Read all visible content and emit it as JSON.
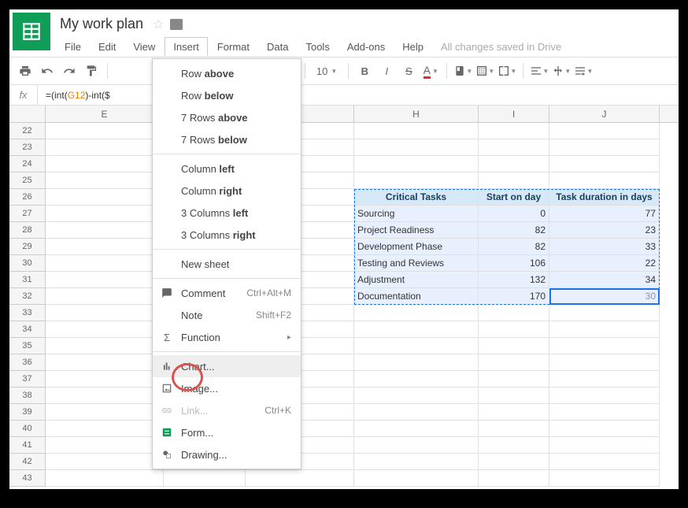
{
  "doc": {
    "title": "My work plan"
  },
  "menu": {
    "file": "File",
    "edit": "Edit",
    "view": "View",
    "insert": "Insert",
    "format": "Format",
    "data": "Data",
    "tools": "Tools",
    "addons": "Add-ons",
    "help": "Help",
    "save_status": "All changes saved in Drive"
  },
  "toolbar": {
    "font_size": "10"
  },
  "formula": {
    "label": "fx",
    "visible": "=(int(G12)-int($"
  },
  "insert_menu": {
    "row_above": "Row above",
    "row_below": "Row below",
    "rows_above": "7 Rows above",
    "rows_below": "7 Rows below",
    "col_left": "Column left",
    "col_right": "Column right",
    "cols_left": "3 Columns left",
    "cols_right": "3 Columns right",
    "new_sheet": "New sheet",
    "comment": "Comment",
    "comment_sc": "Ctrl+Alt+M",
    "note": "Note",
    "note_sc": "Shift+F2",
    "function": "Function",
    "chart": "Chart...",
    "image": "Image...",
    "link": "Link...",
    "link_sc": "Ctrl+K",
    "form": "Form...",
    "drawing": "Drawing..."
  },
  "columns": {
    "E": "E",
    "H": "H",
    "I": "I",
    "J": "J"
  },
  "row_numbers": [
    "22",
    "23",
    "24",
    "25",
    "26",
    "27",
    "28",
    "29",
    "30",
    "31",
    "32",
    "33",
    "34",
    "35",
    "36",
    "37",
    "38",
    "39",
    "40",
    "41",
    "42",
    "43"
  ],
  "table": {
    "header": {
      "h": "Critical Tasks",
      "i": "Start on day",
      "j": "Task duration in days"
    },
    "rows": [
      {
        "h": "Sourcing",
        "i": "0",
        "j": "77"
      },
      {
        "h": "Project Readiness",
        "i": "82",
        "j": "23"
      },
      {
        "h": "Development Phase",
        "i": "82",
        "j": "33"
      },
      {
        "h": "Testing and Reviews",
        "i": "106",
        "j": "22"
      },
      {
        "h": "Adjustment",
        "i": "132",
        "j": "34"
      },
      {
        "h": "Documentation",
        "i": "170",
        "j": "30"
      }
    ]
  }
}
